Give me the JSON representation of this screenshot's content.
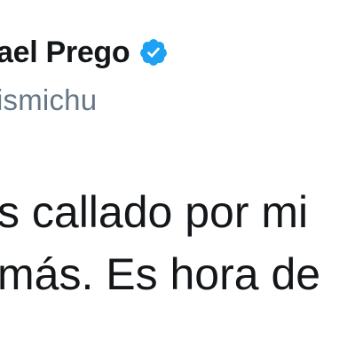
{
  "tweet": {
    "author": {
      "display_name": "ael Prego",
      "handle": "ismichu",
      "verified_icon": "verified-badge-icon"
    },
    "text_lines": [
      "s callado por mi",
      "más. Es hora de"
    ]
  },
  "colors": {
    "text_primary": "#14171a",
    "handle_gray": "#657786",
    "verified_blue": "#1da1f2",
    "background": "#ffffff"
  }
}
